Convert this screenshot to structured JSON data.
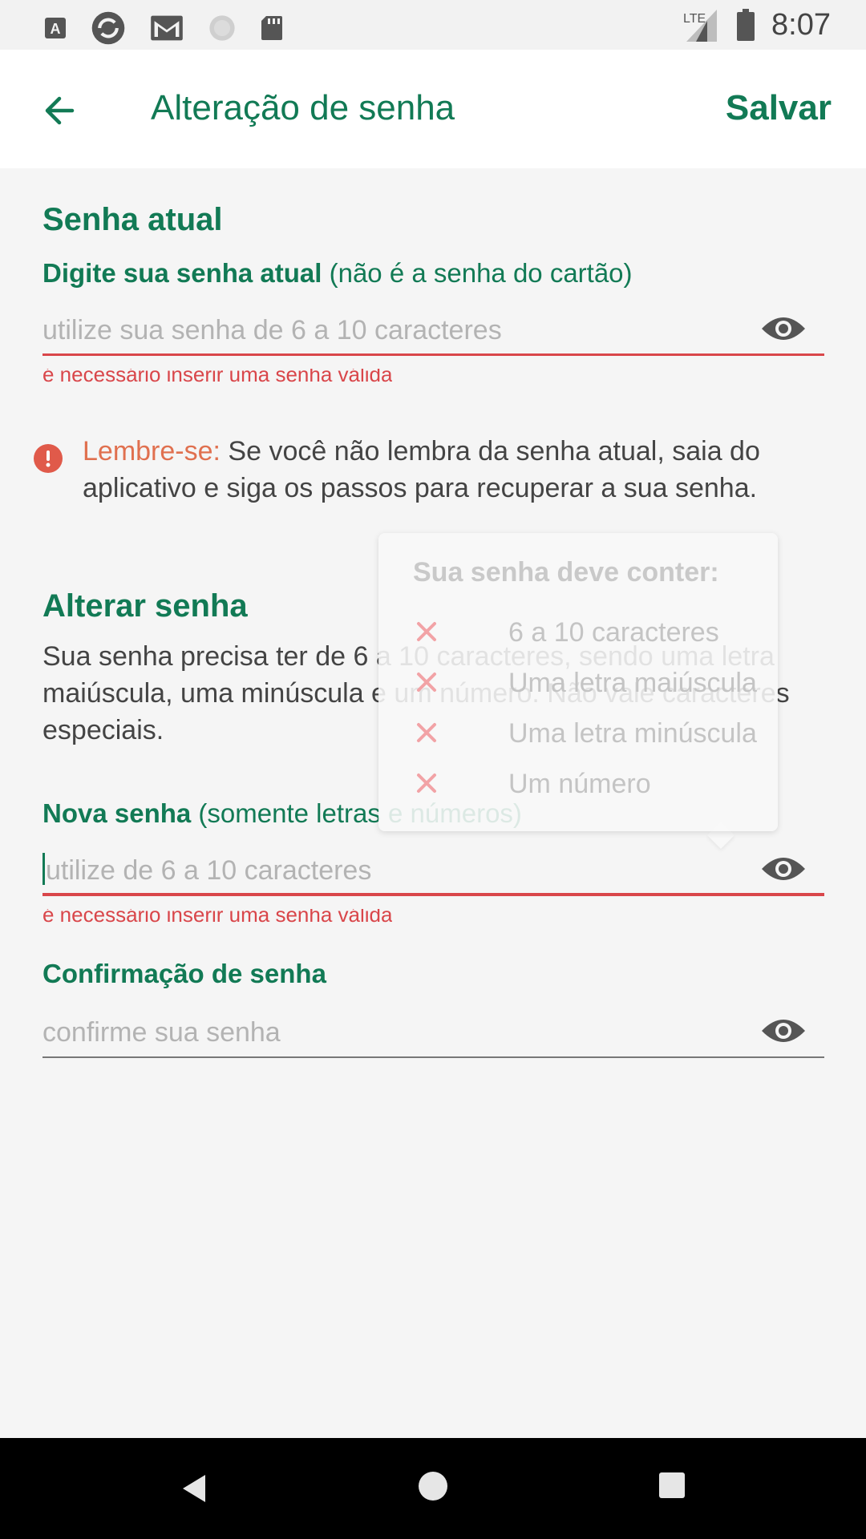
{
  "status_bar": {
    "time": "8:07",
    "network": "LTE",
    "icons": [
      "text-a-icon",
      "sync-icon",
      "gmail-icon",
      "loading-icon",
      "sd-card-icon",
      "signal-icon",
      "battery-icon"
    ]
  },
  "app_bar": {
    "title": "Alteração de senha",
    "save_label": "Salvar",
    "back_icon": "arrow-left-icon"
  },
  "current_password": {
    "section_title": "Senha atual",
    "label_bold": "Digite sua senha atual",
    "label_note": " (não é a senha do cartão)",
    "placeholder": "utilize sua senha de 6 a 10 caracteres",
    "value": "",
    "error": "é necessário inserir uma senha válida"
  },
  "reminder": {
    "label": "Lembre-se:",
    "text": " Se você não lembra da senha atual, saia do aplicativo e siga os passos para recuperar a sua senha."
  },
  "change_password": {
    "section_title": "Alterar senha",
    "description": "Sua senha precisa ter de 6 a 10 caracteres, sendo uma letra maiúscula, uma minúscula e um número. Não vale caracteres especiais.",
    "new_label_bold": "Nova senha",
    "new_label_note": " (somente letras e números)",
    "new_placeholder": "utilize de 6 a 10 caracteres",
    "new_value": "",
    "new_error": "é necessário inserir uma senha válida",
    "confirm_label": "Confirmação de senha",
    "confirm_placeholder": "confirme sua senha",
    "confirm_value": ""
  },
  "tooltip": {
    "title": "Sua senha deve conter:",
    "requirements": [
      {
        "text": "6 a 10 caracteres",
        "met": false
      },
      {
        "text": "Uma letra maiúscula",
        "met": false
      },
      {
        "text": "Uma letra minúscula",
        "met": false
      },
      {
        "text": "Um número",
        "met": false
      }
    ]
  },
  "colors": {
    "primary": "#127a55",
    "error": "#d9464a",
    "reminder": "#e0704f",
    "unmet": "#f2a3a6"
  }
}
